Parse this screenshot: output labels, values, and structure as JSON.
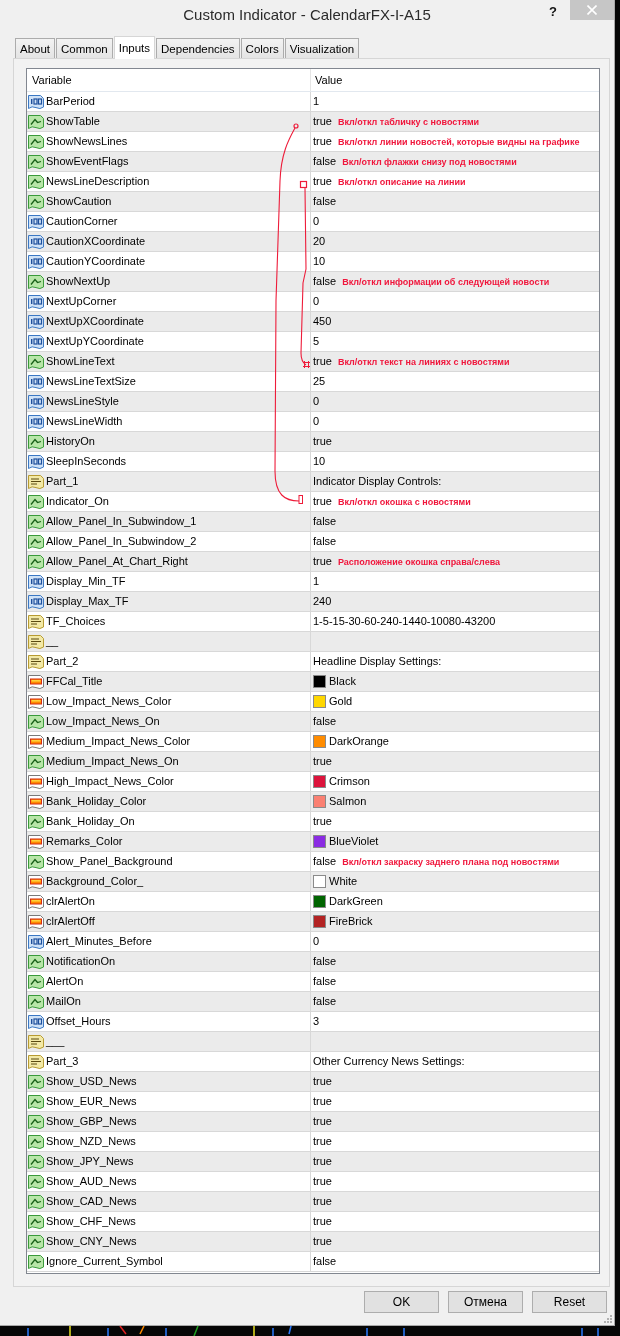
{
  "window": {
    "title": "Custom Indicator - CalendarFX-I-A15",
    "help": "?"
  },
  "tabs": [
    {
      "label": "About",
      "selected": false
    },
    {
      "label": "Common",
      "selected": false
    },
    {
      "label": "Inputs",
      "selected": true
    },
    {
      "label": "Dependencies",
      "selected": false
    },
    {
      "label": "Colors",
      "selected": false
    },
    {
      "label": "Visualization",
      "selected": false
    }
  ],
  "table": {
    "columns": [
      "Variable",
      "Value"
    ],
    "rows": [
      {
        "kind": "number",
        "name": "BarPeriod",
        "value": "1"
      },
      {
        "kind": "bool",
        "name": "ShowTable",
        "value": "true",
        "note": "Вкл/откл табличку с новостями"
      },
      {
        "kind": "bool",
        "name": "ShowNewsLines",
        "value": "true",
        "note": "Вкл/откл линии новостей, которые видны на графике"
      },
      {
        "kind": "bool",
        "name": "ShowEventFlags",
        "value": "false",
        "note": "Вкл/откл флажки снизу под новостями"
      },
      {
        "kind": "bool",
        "name": "NewsLineDescription",
        "value": "true",
        "note": "Вкл/откл описание на линии"
      },
      {
        "kind": "bool",
        "name": "ShowCaution",
        "value": "false"
      },
      {
        "kind": "number",
        "name": "CautionCorner",
        "value": "0"
      },
      {
        "kind": "number",
        "name": "CautionXCoordinate",
        "value": "20"
      },
      {
        "kind": "number",
        "name": "CautionYCoordinate",
        "value": "10"
      },
      {
        "kind": "bool",
        "name": "ShowNextUp",
        "value": "false",
        "note": "Вкл/откл информации об следующей новости"
      },
      {
        "kind": "number",
        "name": "NextUpCorner",
        "value": "0"
      },
      {
        "kind": "number",
        "name": "NextUpXCoordinate",
        "value": "450"
      },
      {
        "kind": "number",
        "name": "NextUpYCoordinate",
        "value": "5"
      },
      {
        "kind": "bool",
        "name": "ShowLineText",
        "value": "true",
        "note": "Вкл/откл текст на линиях с новостями"
      },
      {
        "kind": "number",
        "name": "NewsLineTextSize",
        "value": "25"
      },
      {
        "kind": "number",
        "name": "NewsLineStyle",
        "value": "0"
      },
      {
        "kind": "number",
        "name": "NewsLineWidth",
        "value": "0"
      },
      {
        "kind": "bool",
        "name": "HistoryOn",
        "value": "true"
      },
      {
        "kind": "number",
        "name": "SleepInSeconds",
        "value": "10"
      },
      {
        "kind": "string",
        "name": "Part_1",
        "value": "Indicator Display Controls:"
      },
      {
        "kind": "bool",
        "name": "Indicator_On",
        "value": "true",
        "note": "Вкл/откл окошка с новостями"
      },
      {
        "kind": "bool",
        "name": "Allow_Panel_In_Subwindow_1",
        "value": "false"
      },
      {
        "kind": "bool",
        "name": "Allow_Panel_In_Subwindow_2",
        "value": "false"
      },
      {
        "kind": "bool",
        "name": "Allow_Panel_At_Chart_Right",
        "value": "true",
        "note": "Расположение окошка справа/слева"
      },
      {
        "kind": "number",
        "name": "Display_Min_TF",
        "value": "1"
      },
      {
        "kind": "number",
        "name": "Display_Max_TF",
        "value": "240"
      },
      {
        "kind": "string",
        "name": "TF_Choices",
        "value": "1-5-15-30-60-240-1440-10080-43200"
      },
      {
        "kind": "string",
        "name": "__"
      },
      {
        "kind": "string",
        "name": "Part_2",
        "value": "Headline Display Settings:"
      },
      {
        "kind": "color",
        "name": "FFCal_Title",
        "value": "Black",
        "color": "#000000"
      },
      {
        "kind": "color",
        "name": "Low_Impact_News_Color",
        "value": "Gold",
        "color": "#ffd700"
      },
      {
        "kind": "bool",
        "name": "Low_Impact_News_On",
        "value": "false"
      },
      {
        "kind": "color",
        "name": "Medium_Impact_News_Color",
        "value": "DarkOrange",
        "color": "#ff8c00"
      },
      {
        "kind": "bool",
        "name": "Medium_Impact_News_On",
        "value": "true"
      },
      {
        "kind": "color",
        "name": "High_Impact_News_Color",
        "value": "Crimson",
        "color": "#dc143c"
      },
      {
        "kind": "color",
        "name": "Bank_Holiday_Color",
        "value": "Salmon",
        "color": "#fa8072"
      },
      {
        "kind": "bool",
        "name": "Bank_Holiday_On",
        "value": "true"
      },
      {
        "kind": "color",
        "name": "Remarks_Color",
        "value": "BlueViolet",
        "color": "#8a2be2"
      },
      {
        "kind": "bool",
        "name": "Show_Panel_Background",
        "value": "false",
        "note": "Вкл/откл закраску заднего плана под новостями"
      },
      {
        "kind": "color",
        "name": "Background_Color_",
        "value": "White",
        "color": "#ffffff"
      },
      {
        "kind": "color",
        "name": "clrAlertOn",
        "value": "DarkGreen",
        "color": "#006400"
      },
      {
        "kind": "color",
        "name": "clrAlertOff",
        "value": "FireBrick",
        "color": "#b22222"
      },
      {
        "kind": "number",
        "name": "Alert_Minutes_Before",
        "value": "0"
      },
      {
        "kind": "bool",
        "name": "NotificationOn",
        "value": "false"
      },
      {
        "kind": "bool",
        "name": "AlertOn",
        "value": "false"
      },
      {
        "kind": "bool",
        "name": "MailOn",
        "value": "false"
      },
      {
        "kind": "number",
        "name": "Offset_Hours",
        "value": "3"
      },
      {
        "kind": "string",
        "name": "___"
      },
      {
        "kind": "string",
        "name": "Part_3",
        "value": "Other Currency News Settings:"
      },
      {
        "kind": "bool",
        "name": "Show_USD_News",
        "value": "true"
      },
      {
        "kind": "bool",
        "name": "Show_EUR_News",
        "value": "true"
      },
      {
        "kind": "bool",
        "name": "Show_GBP_News",
        "value": "true"
      },
      {
        "kind": "bool",
        "name": "Show_NZD_News",
        "value": "true"
      },
      {
        "kind": "bool",
        "name": "Show_JPY_News",
        "value": "true"
      },
      {
        "kind": "bool",
        "name": "Show_AUD_News",
        "value": "true"
      },
      {
        "kind": "bool",
        "name": "Show_CAD_News",
        "value": "true"
      },
      {
        "kind": "bool",
        "name": "Show_CHF_News",
        "value": "true"
      },
      {
        "kind": "bool",
        "name": "Show_CNY_News",
        "value": "true"
      },
      {
        "kind": "bool",
        "name": "Ignore_Current_Symbol",
        "value": "false"
      }
    ]
  },
  "buttons": [
    "OK",
    "Отмена",
    "Reset"
  ]
}
